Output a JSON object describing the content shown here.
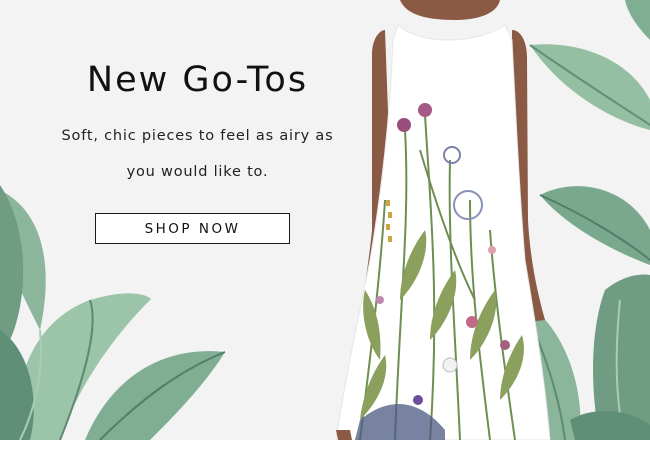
{
  "hero": {
    "headline": "New Go-Tos",
    "subtext_line1": "Soft, chic pieces to feel as airy as",
    "subtext_line2": "you would like to.",
    "cta_label": "SHOP NOW"
  },
  "colors": {
    "background": "#f3f3f3",
    "leaf": "#7fa98f",
    "leaf_dark": "#4f7f68",
    "dress": "#ffffff",
    "skin": "#8a5a44",
    "text": "#111111"
  },
  "images": {
    "model": "model-in-floral-dress",
    "foliage": "tropical-leaves-icon"
  }
}
